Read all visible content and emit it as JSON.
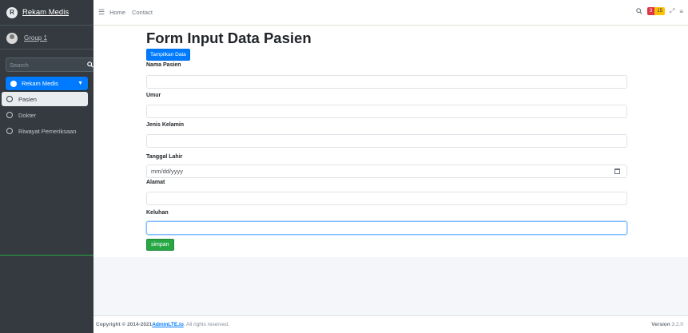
{
  "brand": {
    "name": "Rekam Medis",
    "logo_letter": "R"
  },
  "user": {
    "name": "Group 1"
  },
  "search": {
    "placeholder": "Search"
  },
  "sidebar": {
    "menu_label": "Rekam Medis",
    "items": [
      {
        "label": "Pasien"
      },
      {
        "label": "Dokter"
      },
      {
        "label": "Riwayat Pemeriksaan"
      }
    ]
  },
  "navbar": {
    "links": [
      "Home",
      "Contact"
    ],
    "badges": {
      "red": "3",
      "yellow": "15"
    }
  },
  "form": {
    "title": "Form Input Data Pasien",
    "show_button": "Tampilkan Data",
    "fields": [
      {
        "label": "Nama Pasien",
        "value": ""
      },
      {
        "label": "Umur",
        "value": ""
      },
      {
        "label": "Jenis Kelamin",
        "value": ""
      },
      {
        "label": "Tanggal Lahir",
        "value": "mm/dd/yyyy"
      },
      {
        "label": "Alamat",
        "value": ""
      },
      {
        "label": "Keluhan",
        "value": ""
      }
    ],
    "submit_button": "simpan"
  },
  "footer": {
    "copyright_prefix": "Copyright © 2014-2021 ",
    "copyright_link": "AdminLTE.io",
    "copyright_suffix": ". All rights reserved.",
    "version_label": "Version",
    "version_number": "3.2.0"
  },
  "colors": {
    "primary": "#007bff",
    "success": "#28a745",
    "sidebar": "#343a40"
  }
}
